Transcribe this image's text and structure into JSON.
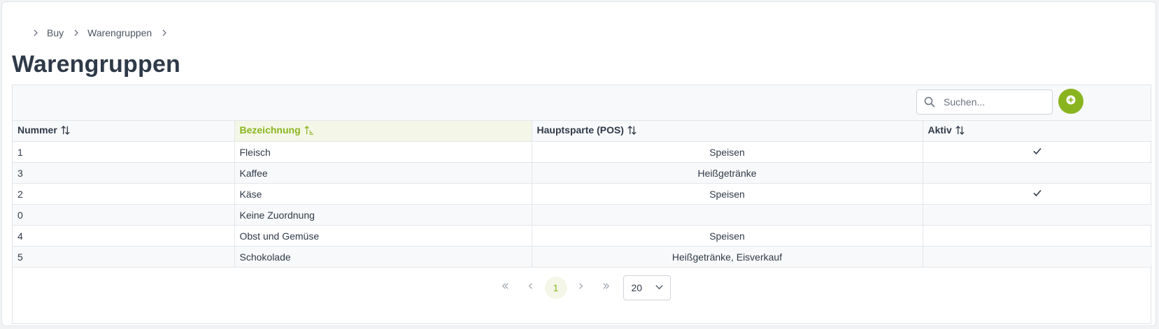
{
  "breadcrumb": [
    "Buy",
    "Warengruppen"
  ],
  "page_title": "Warengruppen",
  "search": {
    "placeholder": "Suchen...",
    "value": ""
  },
  "columns": [
    "Nummer",
    "Bezeichnung",
    "Hauptsparte (POS)",
    "Aktiv"
  ],
  "sorted_column": "Bezeichnung",
  "rows": [
    {
      "nummer": "1",
      "bezeichnung": "Fleisch",
      "hauptsparte": "Speisen",
      "aktiv": true
    },
    {
      "nummer": "3",
      "bezeichnung": "Kaffee",
      "hauptsparte": "Heißgetränke",
      "aktiv": false
    },
    {
      "nummer": "2",
      "bezeichnung": "Käse",
      "hauptsparte": "Speisen",
      "aktiv": true
    },
    {
      "nummer": "0",
      "bezeichnung": "Keine Zuordnung",
      "hauptsparte": "",
      "aktiv": false
    },
    {
      "nummer": "4",
      "bezeichnung": "Obst und Gemüse",
      "hauptsparte": "Speisen",
      "aktiv": false
    },
    {
      "nummer": "5",
      "bezeichnung": "Schokolade",
      "hauptsparte": "Heißgetränke, Eisverkauf",
      "aktiv": false
    }
  ],
  "pagination": {
    "current_page": "1",
    "rows_per_page": "20"
  },
  "colors": {
    "accent": "#8ab41f",
    "text": "#2f3a48"
  },
  "icons": {
    "breadcrumb_separator": "chevron-right-icon",
    "search": "search-icon",
    "add": "plus-circle-icon",
    "sort": "sort-icon",
    "sort_active": "sort-ascending-icon",
    "active": "check-icon",
    "first": "double-chevron-left-icon",
    "prev": "chevron-left-icon",
    "next": "chevron-right-icon",
    "last": "double-chevron-right-icon",
    "dropdown": "chevron-down-icon"
  }
}
